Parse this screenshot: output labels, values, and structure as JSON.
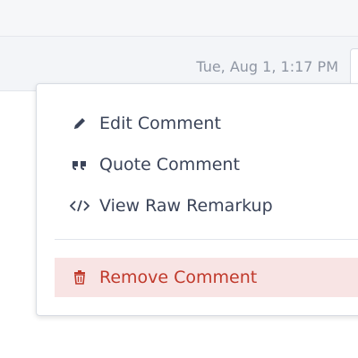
{
  "header": {
    "timestamp": "Tue, Aug 1, 1:17 PM"
  },
  "menu": {
    "items": [
      {
        "label": "Edit Comment",
        "icon": "pencil-icon"
      },
      {
        "label": "Quote Comment",
        "icon": "quote-icon"
      },
      {
        "label": "View Raw Remarkup",
        "icon": "code-icon"
      }
    ],
    "remove": {
      "label": "Remove Comment",
      "icon": "trash-icon",
      "color": "#c0392b",
      "highlight": "#f8e4e4"
    }
  },
  "colors": {
    "text": "#3b4459",
    "timestamp": "#8f96a3",
    "header_bg": "#f3f5f8"
  }
}
